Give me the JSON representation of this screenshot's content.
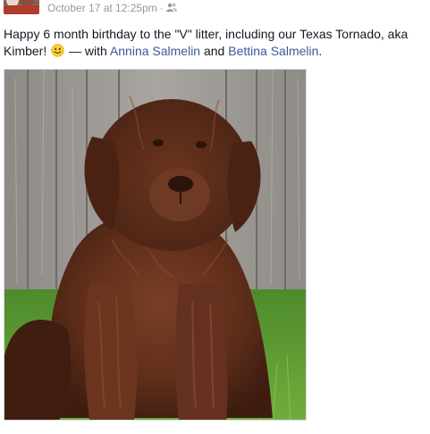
{
  "post": {
    "timestamp": "October 17 at 12:25pm",
    "separator": "·",
    "privacy_icon": "friends-icon",
    "text_main": "Happy 6 month birthday to the \"V\" litter, including our Texas Tornado, aka Kimber!",
    "emoticon": "smiley-icon",
    "with_prefix": " — with ",
    "tagged_1": "Annina Salmelin",
    "conjunction": " and ",
    "tagged_2": "Bettina Salmelin",
    "end_punct": ".",
    "photo_subject": "brown-newfoundland-puppy-photo"
  },
  "colors": {
    "link": "#3b5998",
    "meta": "#9197a3",
    "text": "#141823"
  }
}
